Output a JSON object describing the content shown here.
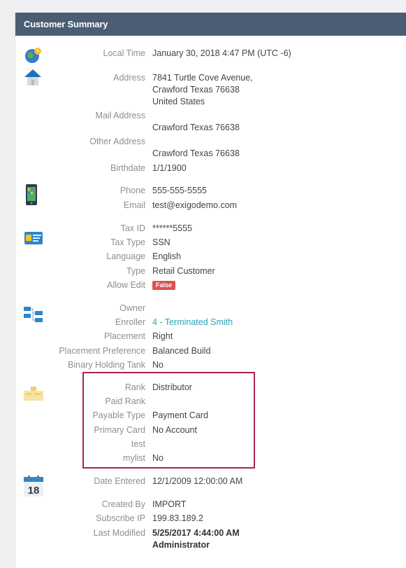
{
  "panel": {
    "title": "Customer Summary"
  },
  "fields": {
    "local_time": {
      "label": "Local Time",
      "value": "January 30, 2018 4:47 PM (UTC -6)"
    },
    "address": {
      "label": "Address",
      "line1": "7841 Turtle Cove Avenue,",
      "line2": "Crawford Texas 76638",
      "line3": "United States"
    },
    "mail_address": {
      "label": "Mail Address",
      "value": "Crawford Texas 76638"
    },
    "other_address": {
      "label": "Other Address",
      "value": "Crawford Texas 76638"
    },
    "birthdate": {
      "label": "Birthdate",
      "value": "1/1/1900"
    },
    "phone": {
      "label": "Phone",
      "value": "555-555-5555"
    },
    "email": {
      "label": "Email",
      "value": "test@exigodemo.com"
    },
    "tax_id": {
      "label": "Tax ID",
      "value": "******5555"
    },
    "tax_type": {
      "label": "Tax Type",
      "value": "SSN"
    },
    "language": {
      "label": "Language",
      "value": "English"
    },
    "type": {
      "label": "Type",
      "value": "Retail Customer"
    },
    "allow_edit": {
      "label": "Allow Edit",
      "value": "False"
    },
    "owner": {
      "label": "Owner",
      "value": ""
    },
    "enroller": {
      "label": "Enroller",
      "value": "4 - Terminated Smith"
    },
    "placement": {
      "label": "Placement",
      "value": "Right"
    },
    "placement_preference": {
      "label": "Placement Preference",
      "value": "Balanced Build"
    },
    "binary_holding_tank": {
      "label": "Binary Holding Tank",
      "value": "No"
    },
    "rank": {
      "label": "Rank",
      "value": "Distributor"
    },
    "paid_rank": {
      "label": "Paid Rank",
      "value": ""
    },
    "payable_type": {
      "label": "Payable Type",
      "value": "Payment Card"
    },
    "primary_card": {
      "label": "Primary Card",
      "value": "No Account"
    },
    "test": {
      "label": "test",
      "value": ""
    },
    "mylist": {
      "label": "mylist",
      "value": "No"
    },
    "date_entered": {
      "label": "Date Entered",
      "value": "12/1/2009 12:00:00 AM"
    },
    "created_by": {
      "label": "Created By",
      "value": "IMPORT"
    },
    "subscribe_ip": {
      "label": "Subscribe IP",
      "value": "199.83.189.2"
    },
    "last_modified": {
      "label": "Last Modified",
      "line1": "5/25/2017 4:44:00 AM",
      "line2": "Administrator"
    }
  },
  "icons": {
    "globe": "globe-clock-icon",
    "house": "house-icon",
    "phone": "mobile-phone-icon",
    "card": "id-card-icon",
    "tree": "org-tree-icon",
    "rank": "rank-icon",
    "calendar": "calendar-icon",
    "calendar_day": "18"
  },
  "colors": {
    "header": "#4a5d72",
    "link": "#29a3b8",
    "badge": "#d9534f",
    "highlight": "#a8224d"
  }
}
